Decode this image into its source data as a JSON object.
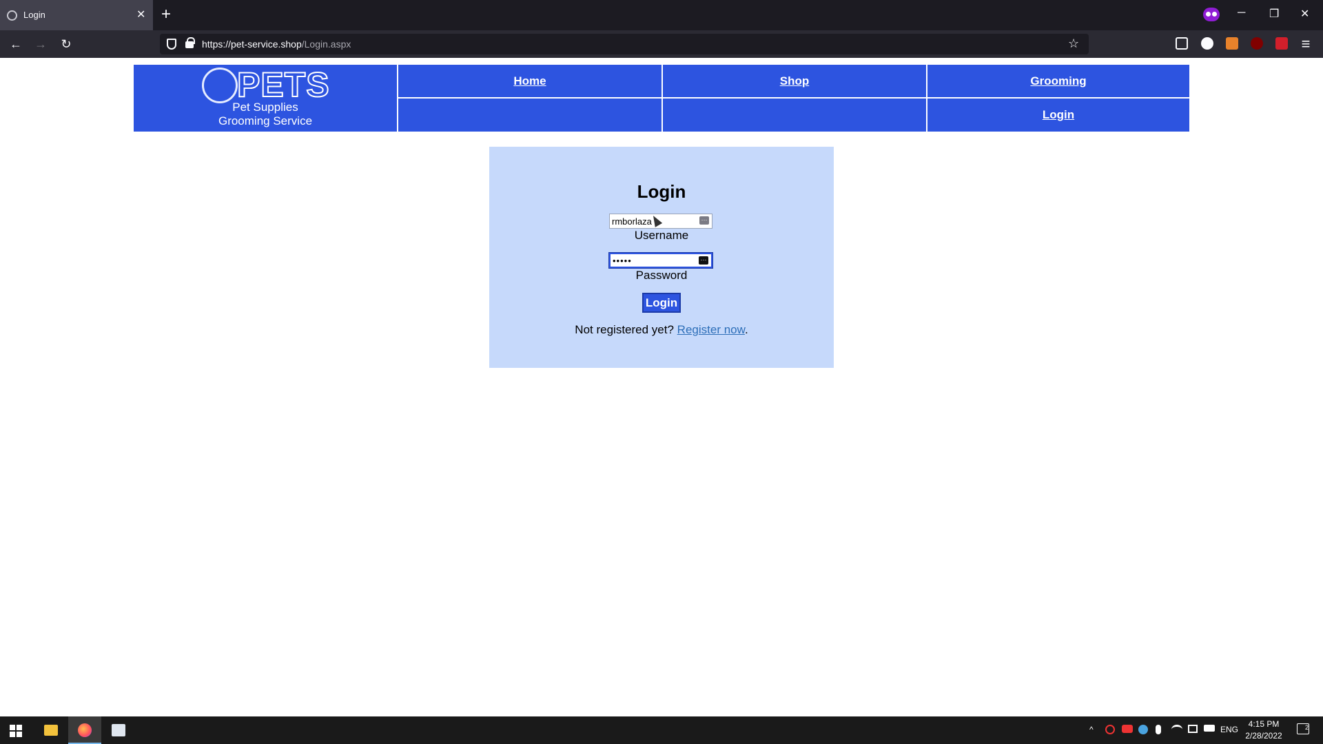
{
  "browser": {
    "tab_title": "Login",
    "tab_close": "✕",
    "new_tab": "+",
    "url_host": "https://pet-service.shop",
    "url_path": "/Login.aspx",
    "back": "←",
    "forward": "→",
    "reload": "↻",
    "bookmark": "☆",
    "menu": "≡",
    "minimize": "─",
    "restore": "❐",
    "close": "✕"
  },
  "site": {
    "logo": {
      "word": "PETS",
      "line1": "Pet Supplies",
      "line2": "Grooming Service"
    },
    "nav": {
      "home": "Home",
      "shop": "Shop",
      "grooming": "Grooming",
      "login": "Login"
    },
    "brand_color": "#2d54e0",
    "panel_color": "#c6d9fb"
  },
  "login": {
    "title": "Login",
    "username_value": "rmborlaza",
    "username_label": "Username",
    "password_value": "•••••",
    "password_label": "Password",
    "button_label": "Login",
    "register_prompt": "Not registered yet?",
    "register_link": "Register now",
    "register_suffix": "."
  },
  "taskbar": {
    "language": "ENG",
    "time": "4:15 PM",
    "date": "2/28/2022",
    "notification_count": "2",
    "tray_chevron": "^"
  }
}
